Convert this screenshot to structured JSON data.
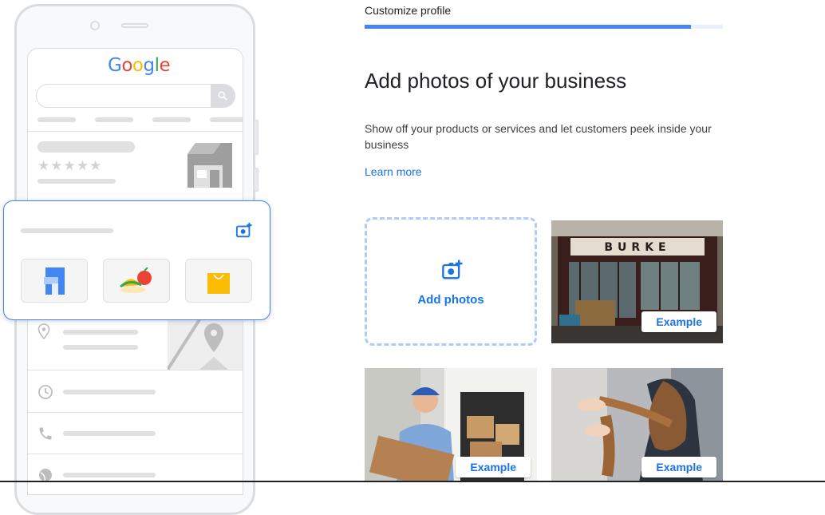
{
  "header": {
    "step_label": "Customize profile",
    "progress_fraction": 0.91
  },
  "main": {
    "title": "Add photos of your business",
    "description": "Show off your products or services and let customers peek inside your business",
    "learn_more": "Learn more",
    "add_photos_label": "Add photos",
    "examples": [
      {
        "label": "Example",
        "sign_text": "BURKE"
      },
      {
        "label": "Example"
      },
      {
        "label": "Example"
      }
    ]
  },
  "phone": {
    "logo_text": "Google",
    "stars": "★★★★★"
  },
  "colors": {
    "accent": "#1a73e8",
    "progress": "#4285f4",
    "dashed_border": "#aecbfa"
  },
  "icons": [
    "add-photo-icon",
    "search-icon",
    "store-icon",
    "location-pin-icon",
    "clock-icon",
    "phone-icon",
    "globe-icon",
    "map-pin-icon"
  ]
}
